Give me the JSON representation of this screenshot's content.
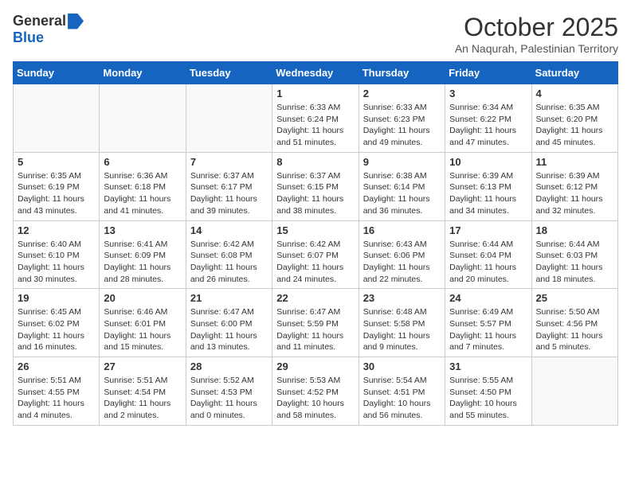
{
  "logo": {
    "general": "General",
    "blue": "Blue"
  },
  "title": "October 2025",
  "subtitle": "An Naqurah, Palestinian Territory",
  "headers": [
    "Sunday",
    "Monday",
    "Tuesday",
    "Wednesday",
    "Thursday",
    "Friday",
    "Saturday"
  ],
  "weeks": [
    [
      {
        "day": "",
        "text": ""
      },
      {
        "day": "",
        "text": ""
      },
      {
        "day": "",
        "text": ""
      },
      {
        "day": "1",
        "text": "Sunrise: 6:33 AM\nSunset: 6:24 PM\nDaylight: 11 hours\nand 51 minutes."
      },
      {
        "day": "2",
        "text": "Sunrise: 6:33 AM\nSunset: 6:23 PM\nDaylight: 11 hours\nand 49 minutes."
      },
      {
        "day": "3",
        "text": "Sunrise: 6:34 AM\nSunset: 6:22 PM\nDaylight: 11 hours\nand 47 minutes."
      },
      {
        "day": "4",
        "text": "Sunrise: 6:35 AM\nSunset: 6:20 PM\nDaylight: 11 hours\nand 45 minutes."
      }
    ],
    [
      {
        "day": "5",
        "text": "Sunrise: 6:35 AM\nSunset: 6:19 PM\nDaylight: 11 hours\nand 43 minutes."
      },
      {
        "day": "6",
        "text": "Sunrise: 6:36 AM\nSunset: 6:18 PM\nDaylight: 11 hours\nand 41 minutes."
      },
      {
        "day": "7",
        "text": "Sunrise: 6:37 AM\nSunset: 6:17 PM\nDaylight: 11 hours\nand 39 minutes."
      },
      {
        "day": "8",
        "text": "Sunrise: 6:37 AM\nSunset: 6:15 PM\nDaylight: 11 hours\nand 38 minutes."
      },
      {
        "day": "9",
        "text": "Sunrise: 6:38 AM\nSunset: 6:14 PM\nDaylight: 11 hours\nand 36 minutes."
      },
      {
        "day": "10",
        "text": "Sunrise: 6:39 AM\nSunset: 6:13 PM\nDaylight: 11 hours\nand 34 minutes."
      },
      {
        "day": "11",
        "text": "Sunrise: 6:39 AM\nSunset: 6:12 PM\nDaylight: 11 hours\nand 32 minutes."
      }
    ],
    [
      {
        "day": "12",
        "text": "Sunrise: 6:40 AM\nSunset: 6:10 PM\nDaylight: 11 hours\nand 30 minutes."
      },
      {
        "day": "13",
        "text": "Sunrise: 6:41 AM\nSunset: 6:09 PM\nDaylight: 11 hours\nand 28 minutes."
      },
      {
        "day": "14",
        "text": "Sunrise: 6:42 AM\nSunset: 6:08 PM\nDaylight: 11 hours\nand 26 minutes."
      },
      {
        "day": "15",
        "text": "Sunrise: 6:42 AM\nSunset: 6:07 PM\nDaylight: 11 hours\nand 24 minutes."
      },
      {
        "day": "16",
        "text": "Sunrise: 6:43 AM\nSunset: 6:06 PM\nDaylight: 11 hours\nand 22 minutes."
      },
      {
        "day": "17",
        "text": "Sunrise: 6:44 AM\nSunset: 6:04 PM\nDaylight: 11 hours\nand 20 minutes."
      },
      {
        "day": "18",
        "text": "Sunrise: 6:44 AM\nSunset: 6:03 PM\nDaylight: 11 hours\nand 18 minutes."
      }
    ],
    [
      {
        "day": "19",
        "text": "Sunrise: 6:45 AM\nSunset: 6:02 PM\nDaylight: 11 hours\nand 16 minutes."
      },
      {
        "day": "20",
        "text": "Sunrise: 6:46 AM\nSunset: 6:01 PM\nDaylight: 11 hours\nand 15 minutes."
      },
      {
        "day": "21",
        "text": "Sunrise: 6:47 AM\nSunset: 6:00 PM\nDaylight: 11 hours\nand 13 minutes."
      },
      {
        "day": "22",
        "text": "Sunrise: 6:47 AM\nSunset: 5:59 PM\nDaylight: 11 hours\nand 11 minutes."
      },
      {
        "day": "23",
        "text": "Sunrise: 6:48 AM\nSunset: 5:58 PM\nDaylight: 11 hours\nand 9 minutes."
      },
      {
        "day": "24",
        "text": "Sunrise: 6:49 AM\nSunset: 5:57 PM\nDaylight: 11 hours\nand 7 minutes."
      },
      {
        "day": "25",
        "text": "Sunrise: 5:50 AM\nSunset: 4:56 PM\nDaylight: 11 hours\nand 5 minutes."
      }
    ],
    [
      {
        "day": "26",
        "text": "Sunrise: 5:51 AM\nSunset: 4:55 PM\nDaylight: 11 hours\nand 4 minutes."
      },
      {
        "day": "27",
        "text": "Sunrise: 5:51 AM\nSunset: 4:54 PM\nDaylight: 11 hours\nand 2 minutes."
      },
      {
        "day": "28",
        "text": "Sunrise: 5:52 AM\nSunset: 4:53 PM\nDaylight: 11 hours\nand 0 minutes."
      },
      {
        "day": "29",
        "text": "Sunrise: 5:53 AM\nSunset: 4:52 PM\nDaylight: 10 hours\nand 58 minutes."
      },
      {
        "day": "30",
        "text": "Sunrise: 5:54 AM\nSunset: 4:51 PM\nDaylight: 10 hours\nand 56 minutes."
      },
      {
        "day": "31",
        "text": "Sunrise: 5:55 AM\nSunset: 4:50 PM\nDaylight: 10 hours\nand 55 minutes."
      },
      {
        "day": "",
        "text": ""
      }
    ]
  ]
}
